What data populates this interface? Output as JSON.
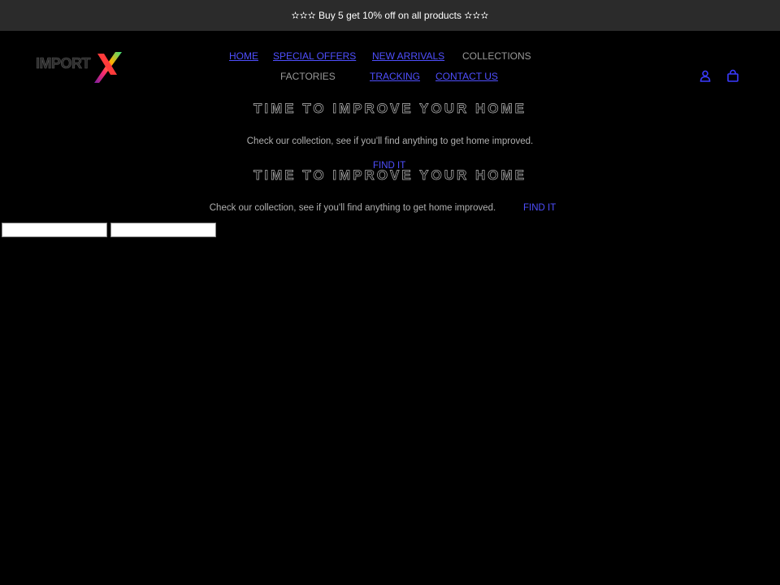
{
  "announcement": {
    "text": "✫✫✫ Buy 5 get 10% off on all products ✫✫✫"
  },
  "logo": {
    "text": "IMPORT"
  },
  "nav": {
    "home": "HOME",
    "special_offers": "SPECIAL OFFERS",
    "new_arrivals": "NEW ARRIVALS",
    "collections": "COLLECTIONS",
    "factories": "FACTORIES",
    "tracking": "TRACKING",
    "contact_us": "CONTACT US"
  },
  "icons": {
    "account": "user-icon",
    "cart": "cart-icon",
    "logo_mark": "x-logo-icon"
  },
  "hero": [
    {
      "title": "TIME TO IMPROVE YOUR HOME",
      "subtitle": "Check our collection, see if you'll find anything to get home improved.",
      "link": "FIND IT"
    },
    {
      "title": "TIME TO IMPROVE YOUR HOME",
      "subtitle": "Check our collection, see if you'll find anything to get home improved.",
      "link": "FIND IT"
    }
  ],
  "colors": {
    "background": "#000000",
    "announcement_bar": "#2b2b2b",
    "link": "#4f4fff",
    "muted": "#999999"
  }
}
